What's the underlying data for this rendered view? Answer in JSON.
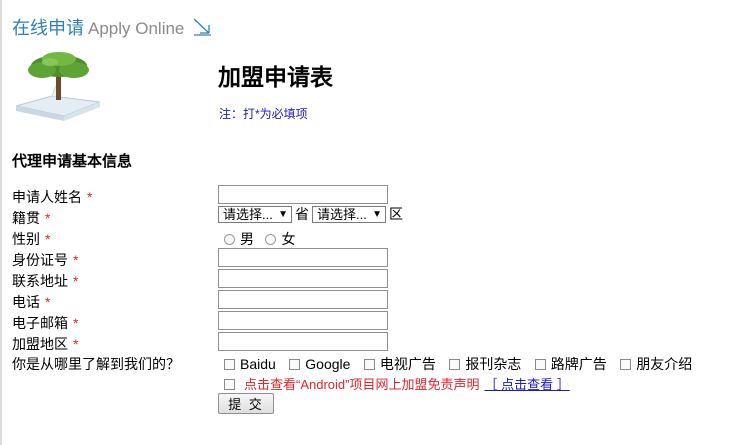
{
  "header": {
    "title_cn": "在线申请",
    "title_en": "Apply Online"
  },
  "form": {
    "title": "加盟申请表",
    "note": "注：打*为必填项",
    "section_title": "代理申请基本信息",
    "required_mark": "*",
    "labels": {
      "name": "申请人姓名",
      "origin": "籍贯",
      "gender": "性别",
      "id_number": "身份证号",
      "address": "联系地址",
      "phone": "电话",
      "email": "电子邮箱",
      "region": "加盟地区",
      "source": "你是从哪里了解到我们的？"
    },
    "origin": {
      "province_select": "请选择...",
      "province_suffix": "省",
      "district_select": "请选择...",
      "district_suffix": "区"
    },
    "gender_options": [
      "男",
      "女"
    ],
    "source_options": [
      "Baidu",
      "Google",
      "电视广告",
      "报刊杂志",
      "路牌广告",
      "朋友介绍"
    ],
    "consent": {
      "text": "点击查看“Android”项目网上加盟免责声明",
      "link": "［ 点击查看 ］"
    },
    "submit_label": "提 交"
  }
}
